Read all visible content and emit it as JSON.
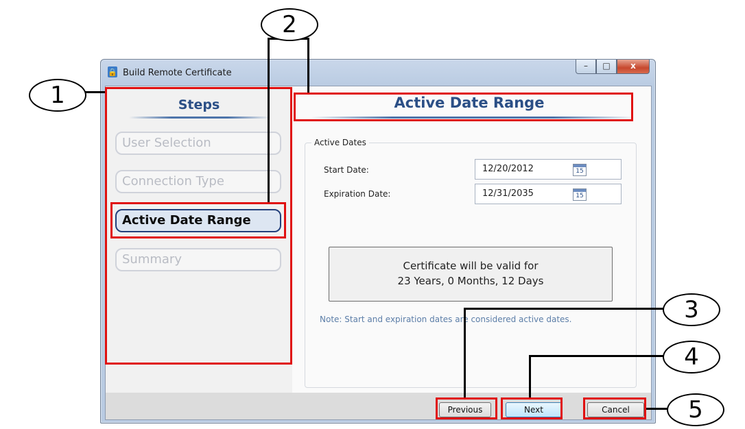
{
  "window": {
    "title": "Build Remote Certificate",
    "caption_buttons": {
      "minimize": "–",
      "maximize": "□",
      "close": "x"
    }
  },
  "sidebar": {
    "title": "Steps",
    "items": [
      {
        "label": "User Selection",
        "active": false
      },
      {
        "label": "Connection Type",
        "active": false
      },
      {
        "label": "Active Date Range",
        "active": true
      },
      {
        "label": "Summary",
        "active": false
      }
    ]
  },
  "main": {
    "title": "Active Date Range",
    "group_label": "Active Dates",
    "start_date_label": "Start Date:",
    "start_date_value": "12/20/2012",
    "expiration_date_label": "Expiration Date:",
    "expiration_date_value": "12/31/2035",
    "calendar_icon_text": "15",
    "validity_line1": "Certificate will be valid for",
    "validity_line2": "23 Years, 0 Months, 12 Days",
    "note": "Note:  Start and expiration dates are considered active dates."
  },
  "footer": {
    "previous_label": "Previous",
    "next_label": "Next",
    "cancel_label": "Cancel"
  },
  "callouts": [
    "1",
    "2",
    "3",
    "4",
    "5"
  ],
  "colors": {
    "annotation_red": "#e01010",
    "heading_blue": "#2b4f86"
  }
}
